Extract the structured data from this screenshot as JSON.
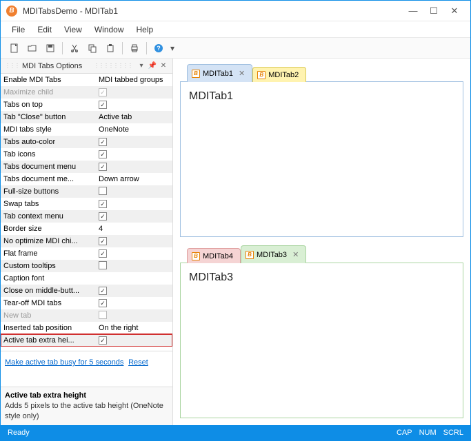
{
  "window": {
    "title": "MDITabsDemo - MDITab1"
  },
  "menu": {
    "file": "File",
    "edit": "Edit",
    "view": "View",
    "window": "Window",
    "help": "Help"
  },
  "panel": {
    "title": "MDI Tabs Options"
  },
  "options": [
    {
      "label": "Enable MDI Tabs",
      "value": "MDI tabbed groups",
      "type": "text",
      "alt": false,
      "disabled": false
    },
    {
      "label": "Maximize child",
      "value": true,
      "type": "check",
      "alt": true,
      "disabled": true
    },
    {
      "label": "Tabs on top",
      "value": true,
      "type": "check",
      "alt": false,
      "disabled": false
    },
    {
      "label": "Tab \"Close\" button",
      "value": "Active tab",
      "type": "text",
      "alt": true,
      "disabled": false
    },
    {
      "label": "MDI tabs style",
      "value": "OneNote",
      "type": "text",
      "alt": false,
      "disabled": false
    },
    {
      "label": "Tabs auto-color",
      "value": true,
      "type": "check",
      "alt": true,
      "disabled": false
    },
    {
      "label": "Tab icons",
      "value": true,
      "type": "check",
      "alt": false,
      "disabled": false
    },
    {
      "label": "Tabs document menu",
      "value": true,
      "type": "check",
      "alt": true,
      "disabled": false
    },
    {
      "label": "Tabs document me...",
      "value": "Down arrow",
      "type": "text",
      "alt": false,
      "disabled": false
    },
    {
      "label": "Full-size buttons",
      "value": false,
      "type": "check",
      "alt": true,
      "disabled": false
    },
    {
      "label": "Swap tabs",
      "value": true,
      "type": "check",
      "alt": false,
      "disabled": false
    },
    {
      "label": "Tab context menu",
      "value": true,
      "type": "check",
      "alt": true,
      "disabled": false
    },
    {
      "label": "Border size",
      "value": "4",
      "type": "text",
      "alt": false,
      "disabled": false
    },
    {
      "label": "No optimize MDI chi...",
      "value": true,
      "type": "check",
      "alt": true,
      "disabled": false
    },
    {
      "label": "Flat frame",
      "value": true,
      "type": "check",
      "alt": false,
      "disabled": false
    },
    {
      "label": "Custom tooltips",
      "value": false,
      "type": "check",
      "alt": true,
      "disabled": false
    },
    {
      "label": "Caption font",
      "value": "",
      "type": "text",
      "alt": false,
      "disabled": false
    },
    {
      "label": "Close on middle-butt...",
      "value": true,
      "type": "check",
      "alt": true,
      "disabled": false
    },
    {
      "label": "Tear-off MDI tabs",
      "value": true,
      "type": "check",
      "alt": false,
      "disabled": false
    },
    {
      "label": "New tab",
      "value": false,
      "type": "check",
      "alt": true,
      "disabled": true
    },
    {
      "label": "Inserted tab position",
      "value": "On the right",
      "type": "text",
      "alt": false,
      "disabled": false
    },
    {
      "label": "Active tab extra hei...",
      "value": true,
      "type": "check",
      "alt": true,
      "disabled": false,
      "highlight": true
    }
  ],
  "links": {
    "busy": "Make active tab busy for 5 seconds",
    "reset": "Reset"
  },
  "desc": {
    "title": "Active tab extra height",
    "text": "Adds 5 pixels to the active tab height (OneNote style only)"
  },
  "group1": {
    "tabs": [
      {
        "label": "MDITab1",
        "color": "blue",
        "active": true,
        "close": true
      },
      {
        "label": "MDITab2",
        "color": "yellow",
        "active": false,
        "close": false
      }
    ],
    "content": "MDITab1",
    "border": "blue-b"
  },
  "group2": {
    "tabs": [
      {
        "label": "MDITab4",
        "color": "red",
        "active": false,
        "close": false
      },
      {
        "label": "MDITab3",
        "color": "green",
        "active": true,
        "close": true
      }
    ],
    "content": "MDITab3",
    "border": "green-b"
  },
  "status": {
    "text": "Ready",
    "cap": "CAP",
    "num": "NUM",
    "scrl": "SCRL"
  }
}
